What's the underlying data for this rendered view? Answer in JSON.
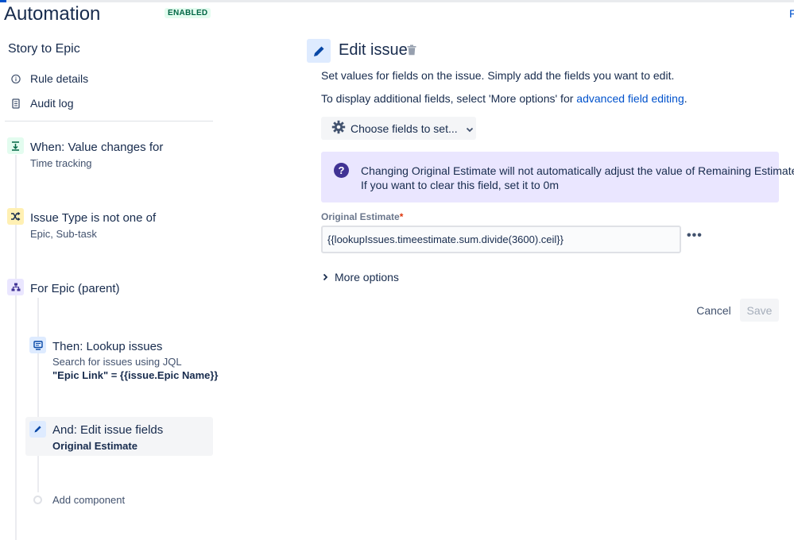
{
  "header": {
    "title": "Automation",
    "status_badge": "ENABLED",
    "edge_link": "F"
  },
  "sidebar": {
    "rule_name": "Story to Epic",
    "links": [
      {
        "label": "Rule details",
        "icon": "info-icon"
      },
      {
        "label": "Audit log",
        "icon": "document-icon"
      }
    ]
  },
  "components": [
    {
      "kind": "trigger",
      "title": "When: Value changes for",
      "subtitle": "Time tracking",
      "icon": "trigger-icon",
      "color": "#e3fcef"
    },
    {
      "kind": "condition",
      "title": "Issue Type is not one of",
      "subtitle": "Epic, Sub-task",
      "icon": "shuffle-icon",
      "color": "#fff0b3"
    },
    {
      "kind": "branch",
      "title": "For Epic (parent)",
      "icon": "hierarchy-icon",
      "color": "#eae6ff"
    },
    {
      "kind": "action",
      "title": "Then: Lookup issues",
      "subtitle": "Search for issues using JQL",
      "subtitle_bold": "\"Epic Link\" = {{issue.Epic Name}}",
      "icon": "monitor-icon",
      "color": "#deebff"
    },
    {
      "kind": "action",
      "title": "And: Edit issue fields",
      "subtitle_bold": "Original Estimate",
      "icon": "pencil-icon",
      "color": "#deebff",
      "selected": true
    }
  ],
  "add_component": "Add component",
  "panel": {
    "title": "Edit issue",
    "description": "Set values for fields on the issue. Simply add the fields you want to edit.",
    "advanced_prefix": "To display additional fields, select 'More options' for ",
    "advanced_link": "advanced field editing",
    "advanced_suffix": ".",
    "choose_fields_label": "Choose fields to set...",
    "info_line1": "Changing Original Estimate will not automatically adjust the value of Remaining Estimate.",
    "info_line2": "If you want to clear this field, set it to 0m",
    "field_label": "Original Estimate",
    "field_required_mark": "*",
    "field_value": "{{lookupIssues.timeestimate.sum.divide(3600).ceil}}",
    "more_options_label": "More options",
    "cancel_label": "Cancel",
    "save_label": "Save",
    "more_actions_glyph": "•••"
  },
  "colors": {
    "link": "#0052cc",
    "info_bg": "#eae6ff",
    "info_icon": "#403294",
    "selected_bg": "#f4f5f7"
  }
}
